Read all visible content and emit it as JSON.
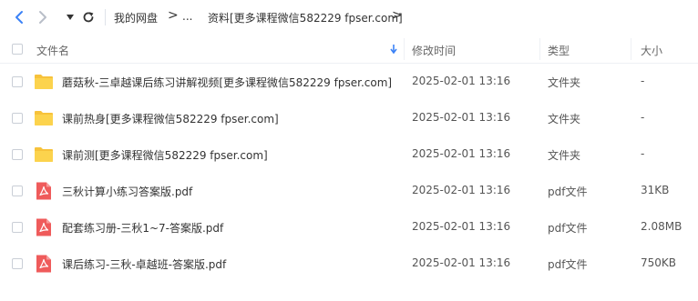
{
  "breadcrumb": {
    "root": "我的网盘",
    "arrow": ">",
    "ellipsis": "...",
    "current": "资料[更多课程微信582229 fpser.com]"
  },
  "toolbar": {
    "back_icon": "chevron-left-icon",
    "forward_icon": "chevron-right-icon",
    "dropdown_icon": "caret-down-icon",
    "refresh_icon": "refresh-icon",
    "accent_color": "#3b82f6"
  },
  "columns": {
    "name": "文件名",
    "modified": "修改时间",
    "type": "类型",
    "size": "大小",
    "sort_icon": "sort-down-arrow-icon"
  },
  "files": [
    {
      "name": "蘑菇秋-三卓越课后练习讲解视频[更多课程微信582229 fpser.com]",
      "modified": "2025-02-01 13:16",
      "type": "文件夹",
      "size": "-",
      "icon": "folder-icon"
    },
    {
      "name": "课前热身[更多课程微信582229 fpser.com]",
      "modified": "2025-02-01 13:16",
      "type": "文件夹",
      "size": "-",
      "icon": "folder-icon"
    },
    {
      "name": "课前测[更多课程微信582229 fpser.com]",
      "modified": "2025-02-01 13:16",
      "type": "文件夹",
      "size": "-",
      "icon": "folder-icon"
    },
    {
      "name": "三秋计算小练习答案版.pdf",
      "modified": "2025-02-01 13:16",
      "type": "pdf文件",
      "size": "31KB",
      "icon": "pdf-icon"
    },
    {
      "name": "配套练习册-三秋1~7-答案版.pdf",
      "modified": "2025-02-01 13:16",
      "type": "pdf文件",
      "size": "2.08MB",
      "icon": "pdf-icon"
    },
    {
      "name": "课后练习-三秋-卓越班-答案版.pdf",
      "modified": "2025-02-01 13:16",
      "type": "pdf文件",
      "size": "750KB",
      "icon": "pdf-icon"
    }
  ]
}
